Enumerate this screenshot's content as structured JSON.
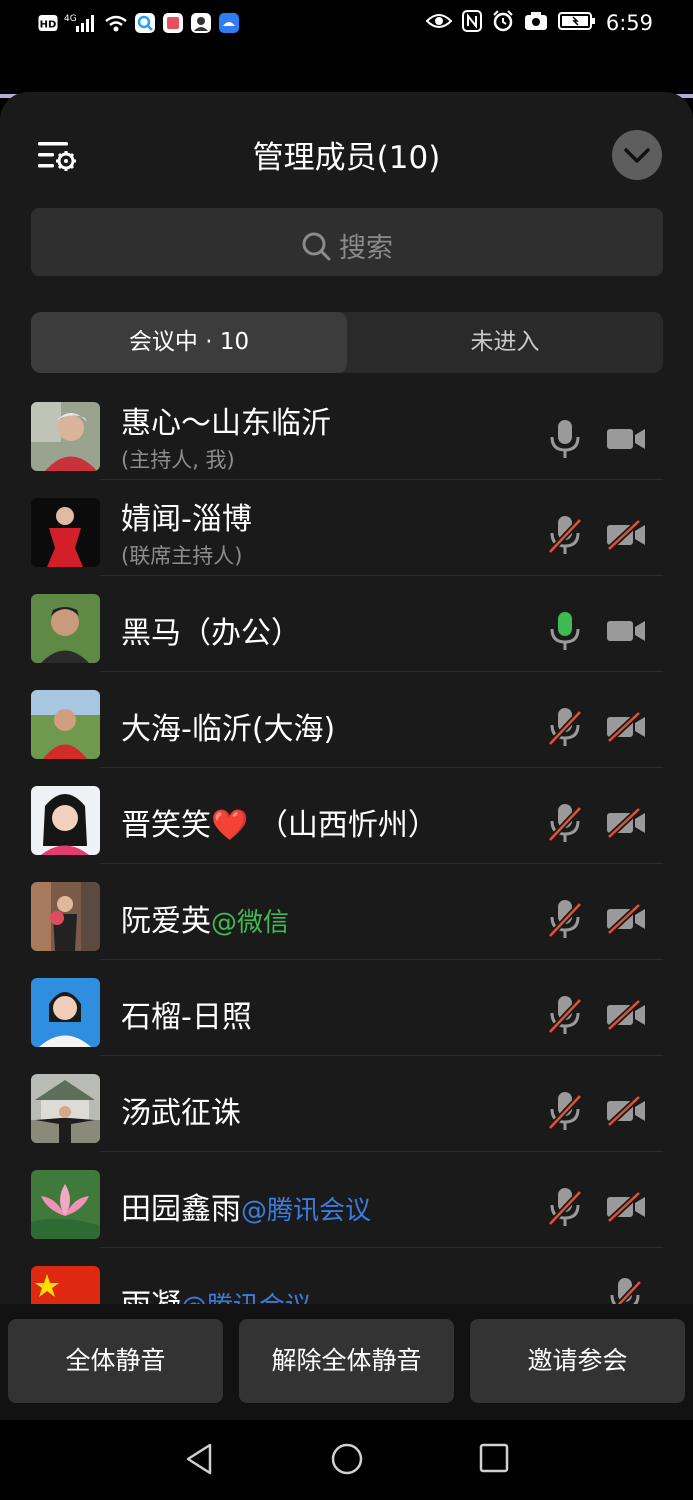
{
  "status_bar": {
    "time": "6:59",
    "left_icons": [
      "hd-icon",
      "4g-signal-icon",
      "wifi-icon",
      "app-notification-icon",
      "app-notification-icon",
      "app-notification-icon",
      "app-notification-icon"
    ],
    "right_icons": [
      "eye-icon",
      "nfc-icon",
      "alarm-icon",
      "camera-icon",
      "battery-icon"
    ],
    "hd_label": "HD",
    "net_label": "4G"
  },
  "header": {
    "title": "管理成员(10)"
  },
  "search": {
    "placeholder": "搜索"
  },
  "tabs": [
    {
      "label": "会议中 · 10",
      "active": true
    },
    {
      "label": "未进入",
      "active": false
    }
  ],
  "members": [
    {
      "name": "惠心～山东临沂",
      "tag": "",
      "subtitle": "(主持人, 我)",
      "mic": "on",
      "camera": "on"
    },
    {
      "name": "婧闻-淄博",
      "tag": "",
      "subtitle": "(联席主持人)",
      "mic": "muted",
      "camera": "off"
    },
    {
      "name": "黑马（办公）",
      "tag": "",
      "subtitle": "",
      "mic": "speaking",
      "camera": "on"
    },
    {
      "name": "大海-临沂(大海)",
      "tag": "",
      "subtitle": "",
      "mic": "muted",
      "camera": "off"
    },
    {
      "name": "晋笑笑❤️ （山西忻州）",
      "tag": "",
      "subtitle": "",
      "mic": "muted",
      "camera": "off"
    },
    {
      "name": "阮爱英",
      "tag": "@微信",
      "tag_color": "green",
      "subtitle": "",
      "mic": "muted",
      "camera": "off"
    },
    {
      "name": "石榴-日照",
      "tag": "",
      "subtitle": "",
      "mic": "muted",
      "camera": "off"
    },
    {
      "name": "汤武征诛",
      "tag": "",
      "subtitle": "",
      "mic": "muted",
      "camera": "off"
    },
    {
      "name": "田园鑫雨",
      "tag": "@腾讯会议",
      "tag_color": "blue",
      "subtitle": "",
      "mic": "muted",
      "camera": "off"
    },
    {
      "name": "雨凝",
      "tag": "@腾讯会议",
      "tag_color": "blue",
      "subtitle": "",
      "mic": "muted",
      "camera": ""
    }
  ],
  "footer": {
    "mute_all": "全体静音",
    "unmute_all": "解除全体静音",
    "invite": "邀请参会"
  },
  "nav_bar": [
    "back-icon",
    "home-icon",
    "recents-icon"
  ],
  "colors": {
    "sheet_bg": "#1a1a1a",
    "muted_red": "#e0503a",
    "speaking_green": "#3fb950",
    "tag_blue": "#3b7ce0",
    "tag_green": "#3fb950"
  }
}
